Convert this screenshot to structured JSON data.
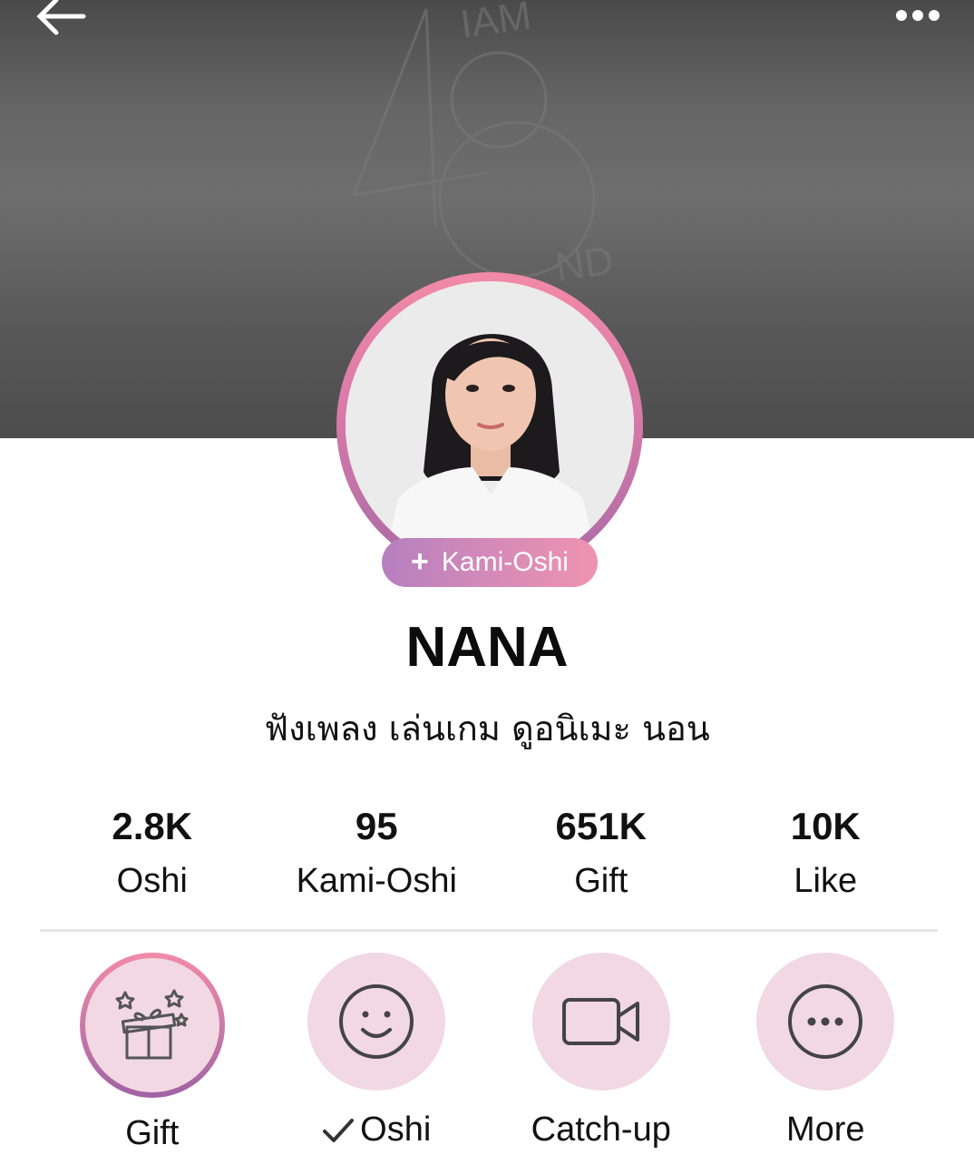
{
  "header": {
    "back_icon": "arrow-left-icon",
    "menu_icon": "more-horizontal-icon",
    "background_color": "#5e5e5e"
  },
  "profile": {
    "name": "NANA",
    "bio": "ฟังเพลง เล่นเกม ดูอนิเมะ นอน",
    "kami_oshi_button": {
      "icon": "plus-icon",
      "label": "Kami-Oshi"
    },
    "accent_gradient": [
      "#f28aa8",
      "#a76aa6"
    ]
  },
  "stats": [
    {
      "value": "2.8K",
      "label": "Oshi"
    },
    {
      "value": "95",
      "label": "Kami-Oshi"
    },
    {
      "value": "651K",
      "label": "Gift"
    },
    {
      "value": "10K",
      "label": "Like"
    }
  ],
  "actions": [
    {
      "label": "Gift",
      "icon": "gift-icon"
    },
    {
      "label": "Oshi",
      "icon": "smile-icon",
      "status_icon": "check-icon"
    },
    {
      "label": "Catch-up",
      "icon": "video-camera-icon"
    },
    {
      "label": "More",
      "icon": "more-circle-icon"
    }
  ],
  "colors": {
    "action_bg": "#f1d8e2",
    "text": "#111111"
  }
}
